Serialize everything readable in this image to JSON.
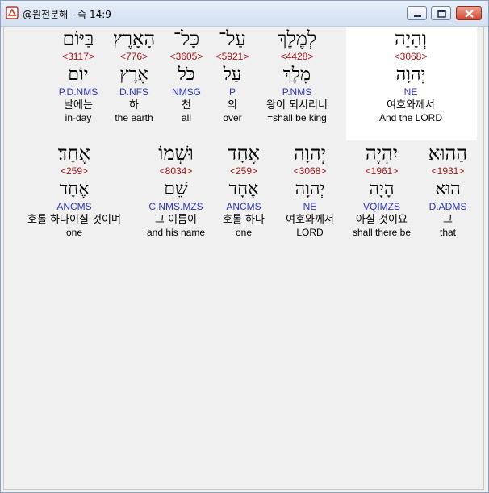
{
  "window": {
    "title": "@원전분해 - 슥 14:9"
  },
  "row1": [
    {
      "hebrew": "וְהָיָה",
      "strong": "<3068>",
      "lemma": "יְהוָה",
      "morph": "NE",
      "korean": "여호와께서",
      "english": "And the LORD"
    },
    {
      "hebrew": "לְמֶלֶךְ",
      "strong": "<4428>",
      "lemma": "מֶלֶךְ",
      "morph": "P.NMS",
      "korean": "왕이 되시리니",
      "english": "=shall be king"
    },
    {
      "hebrew": "עַל־",
      "strong": "<5921>",
      "lemma": "עַל",
      "morph": "P",
      "korean": "의",
      "english": "over"
    },
    {
      "hebrew": "כָּל־",
      "strong": "<3605>",
      "lemma": "כֹּל",
      "morph": "NMSG",
      "korean": "천",
      "english": "all"
    },
    {
      "hebrew": "הָאָרֶץ",
      "strong": "<776>",
      "lemma": "אֶרֶץ",
      "morph": "D.NFS",
      "korean": "하",
      "english": "the earth"
    },
    {
      "hebrew": "בַּיּוֹם",
      "strong": "<3117>",
      "lemma": "יוֹם",
      "morph": "P.D.NMS",
      "korean": "날에는",
      "english": "in-day"
    }
  ],
  "row2": [
    {
      "hebrew": "הַהוּא",
      "strong": "<1931>",
      "lemma": "הוּא",
      "morph": "D.ADMS",
      "korean": "그",
      "english": "that"
    },
    {
      "hebrew": "יִהְיֶה",
      "strong": "<1961>",
      "lemma": "הָיָה",
      "morph": "VQIMZS",
      "korean": "아실 것이요",
      "english": "shall there be"
    },
    {
      "hebrew": "יְהוָה",
      "strong": "<3068>",
      "lemma": "יְהוָה",
      "morph": "NE",
      "korean": "여호와께서",
      "english": "LORD"
    },
    {
      "hebrew": "אֶחָד",
      "strong": "<259>",
      "lemma": "אֶחָד",
      "morph": "ANCMS",
      "korean": "호롤 하나",
      "english": "one"
    },
    {
      "hebrew": "וּשְׁמוֹ",
      "strong": "<8034>",
      "lemma": "שֵׁם",
      "morph": "C.NMS.MZS",
      "korean": "그 이름이",
      "english": "and his name"
    },
    {
      "hebrew": "אֶחָד׃",
      "strong": "<259>",
      "lemma": "אֶחָד",
      "morph": "ANCMS",
      "korean": "호롤 하나이실 것이며",
      "english": "one"
    }
  ]
}
